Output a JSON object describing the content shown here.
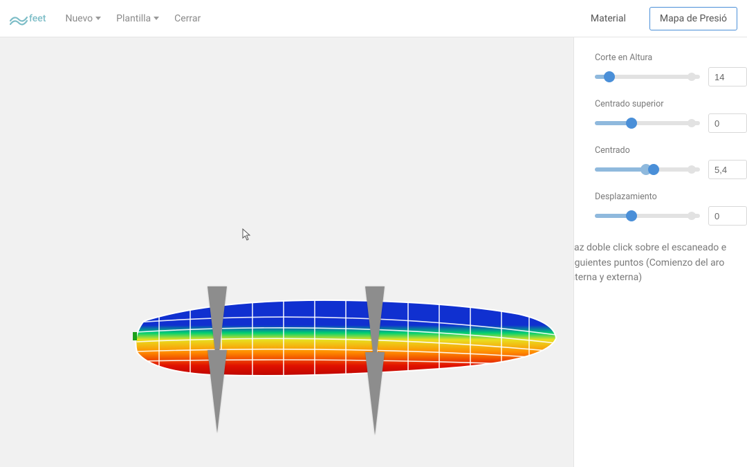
{
  "brand": {
    "name": "feet"
  },
  "menu": {
    "nuevo": "Nuevo",
    "plantilla": "Plantilla",
    "cerrar": "Cerrar"
  },
  "tabs": {
    "material": "Material",
    "presion": "Mapa de Presió"
  },
  "controls": {
    "corte": {
      "label": "Corte en Altura",
      "value": "14",
      "fillPct": 14,
      "thumbPct": 14
    },
    "centradoSup": {
      "label": "Centrado superior",
      "value": "0",
      "fillPct": 35,
      "thumbPct": 35
    },
    "centrado": {
      "label": "Centrado",
      "value": "5,4",
      "fillPct": 55,
      "thumbPct": 55,
      "extraThumbPct": 49
    },
    "desplaz": {
      "label": "Desplazamiento",
      "value": "0",
      "fillPct": 35,
      "thumbPct": 35
    }
  },
  "help": "Haz doble click sobre el escaneado e siguientes puntos (Comienzo del aro interna y externa)"
}
